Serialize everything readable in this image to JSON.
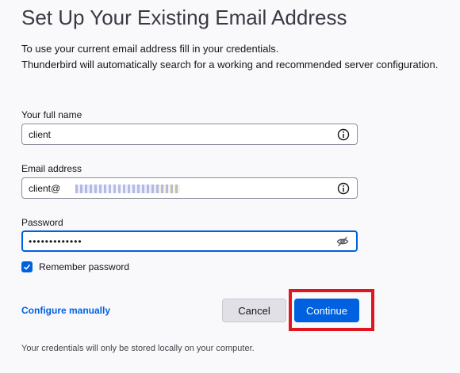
{
  "header": {
    "title": "Set Up Your Existing Email Address",
    "intro_line1": "To use your current email address fill in your credentials.",
    "intro_line2": "Thunderbird will automatically search for a working and recommended server configuration."
  },
  "form": {
    "full_name": {
      "label": "Your full name",
      "value": "client",
      "icon": "info-icon"
    },
    "email": {
      "label": "Email address",
      "value": "client@",
      "icon": "info-icon"
    },
    "password": {
      "label": "Password",
      "value": "•••••••••••••",
      "icon": "eye-slash-icon"
    },
    "remember_password": {
      "label": "Remember password",
      "checked": true
    }
  },
  "actions": {
    "configure_manually": "Configure manually",
    "cancel": "Cancel",
    "continue": "Continue"
  },
  "footer": {
    "note": "Your credentials will only be stored locally on your computer."
  },
  "colors": {
    "accent": "#0061e0",
    "highlight": "#e0151d",
    "background": "#f9f9fb"
  }
}
